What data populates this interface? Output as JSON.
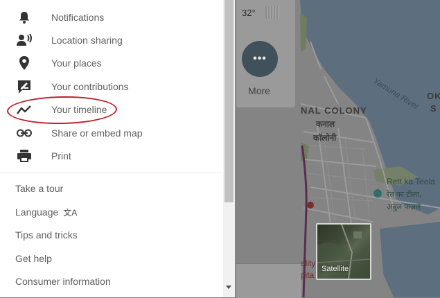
{
  "menu": {
    "items": [
      {
        "label": "Notifications",
        "icon": "bell-icon"
      },
      {
        "label": "Location sharing",
        "icon": "location-sharing-icon"
      },
      {
        "label": "Your places",
        "icon": "pin-icon"
      },
      {
        "label": "Your contributions",
        "icon": "contributions-icon"
      },
      {
        "label": "Your timeline",
        "icon": "timeline-icon"
      },
      {
        "label": "Share or embed map",
        "icon": "link-icon"
      },
      {
        "label": "Print",
        "icon": "printer-icon"
      }
    ],
    "links": {
      "take_a_tour": "Take a tour",
      "language": "Language",
      "tips_and_tricks": "Tips and tricks",
      "get_help": "Get help",
      "consumer_information": "Consumer information"
    },
    "language_icon": "文A"
  },
  "map": {
    "temperature": "32°",
    "more_label": "More",
    "more_icon": "•••",
    "satellite_label": "Satellite",
    "labels": {
      "nal_colony": "NAL COLONY",
      "kanal": "कनाल",
      "kaloni": "कॉलोनी",
      "yamuna_river": "Yamuna River",
      "ok": "OK",
      "s": "S",
      "rett_ka_teela": "Rett ka Teela",
      "rett_hindi": "रेत का टीला,",
      "abul_fazal": "अबुल फज़ल",
      "ality": "ality",
      "pita": "pita"
    }
  },
  "colors": {
    "highlight": "#c0202a",
    "water": "#5d6e7f",
    "land": "#858585"
  }
}
